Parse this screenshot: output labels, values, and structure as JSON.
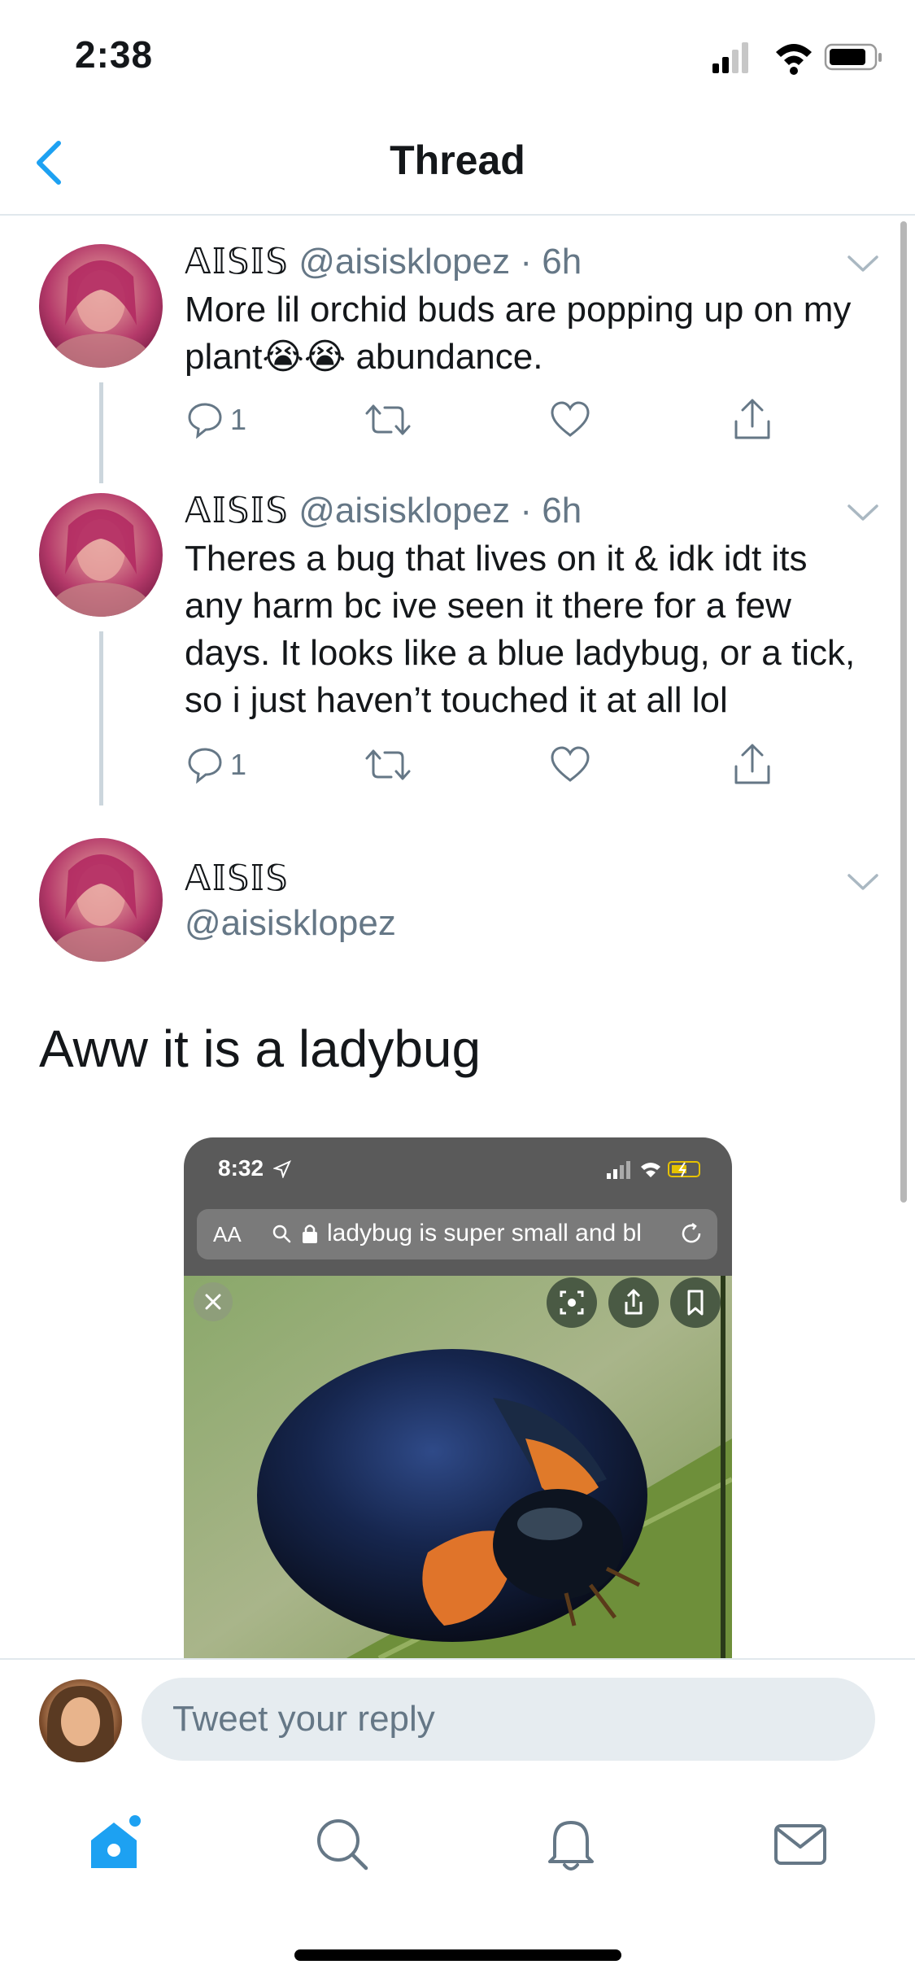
{
  "status_bar": {
    "time": "2:38"
  },
  "nav": {
    "title": "Thread"
  },
  "tweets": [
    {
      "name": "𝔸𝕀𝕊𝕀𝕊",
      "handle": "@aisisklopez",
      "time": "6h",
      "text": "More lil orchid buds are popping up on my plant😭😭 abundance.",
      "replies": "1"
    },
    {
      "name": "𝔸𝕀𝕊𝕀𝕊",
      "handle": "@aisisklopez",
      "time": "6h",
      "text": "Theres a bug that lives on it & idk idt its any harm bc ive seen it there for a few days. It looks like a blue ladybug, or a tick, so i just haven’t touched it at all lol",
      "replies": "1"
    }
  ],
  "focused_tweet": {
    "name": "𝔸𝕀𝕊𝕀𝕊",
    "handle": "@aisisklopez",
    "text": "Aww it is a ladybug",
    "media": {
      "status_time": "8:32",
      "aa_label": "AA",
      "url_text": "ladybug is super small and bl"
    }
  },
  "reply": {
    "placeholder": "Tweet your reply"
  },
  "tabs": [
    "home-icon",
    "search-icon",
    "bell-icon",
    "mail-icon"
  ],
  "colors": {
    "accent": "#1da1f2",
    "secondary_text": "#657786",
    "divider": "#e1e8ed"
  }
}
